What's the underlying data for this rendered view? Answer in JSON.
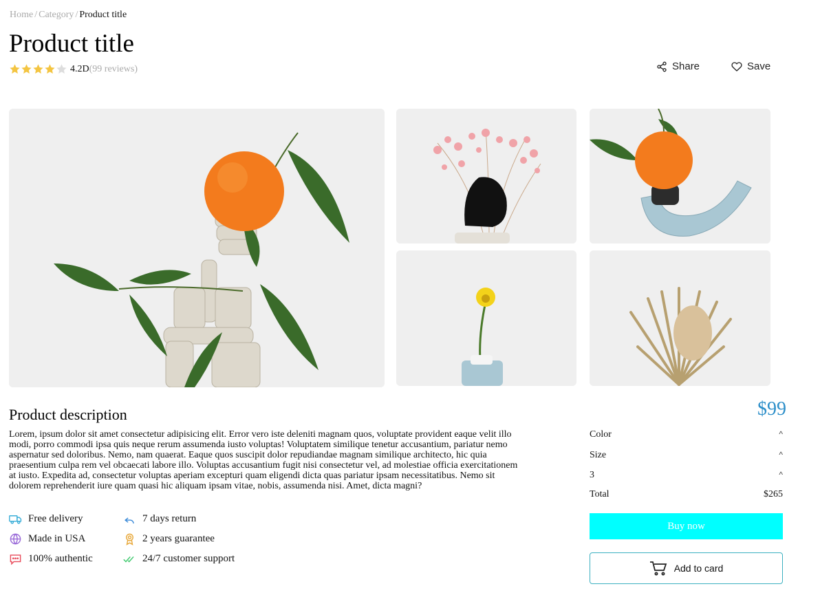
{
  "breadcrumb": {
    "home": "Home",
    "category": "Category",
    "current": "Product title",
    "separator": "/"
  },
  "product": {
    "title": "Product title",
    "rating": {
      "stars_filled": 4,
      "stars_total": 5,
      "value": "4.2D",
      "reviews": "(99 reviews)"
    }
  },
  "actions": {
    "share": "Share",
    "save": "Save",
    "share_icon": "share-icon",
    "save_icon": "heart-icon"
  },
  "gallery": {
    "images": [
      "orange-on-clay-sculpture",
      "pink-flowers-with-black-rock",
      "orange-on-blue-vase",
      "yellow-flower-in-blue-vase",
      "dried-protea-flower"
    ]
  },
  "description": {
    "title": "Product description",
    "text": "Lorem, ipsum dolor sit amet consectetur adipisicing elit. Error vero iste deleniti magnam quos, voluptate provident eaque velit illo modi, porro commodi ipsa quis neque rerum assumenda iusto voluptas! Voluptatem similique tenetur accusantium, pariatur nemo aspernatur sed doloribus. Nemo, nam quaerat. Eaque quos suscipit dolor repudiandae magnam similique architecto, hic quia praesentium culpa rem vel obcaecati labore illo. Voluptas accusantium fugit nisi consectetur vel, ad molestiae officia exercitationem at iusto. Expedita ad, consectetur voluptas aperiam excepturi quam eligendi dicta quas pariatur ipsam necessitatibus. Nemo sit dolorem reprehenderit iure quam quasi hic aliquam ipsam vitae, nobis, assumenda nisi. Amet, dicta magni?"
  },
  "features": [
    {
      "label": "Free delivery",
      "icon": "truck-icon"
    },
    {
      "label": "7 days return",
      "icon": "return-arrow-icon"
    },
    {
      "label": "Made in USA",
      "icon": "globe-icon"
    },
    {
      "label": "2 years guarantee",
      "icon": "award-icon"
    },
    {
      "label": "100% authentic",
      "icon": "chat-icon"
    },
    {
      "label": "24/7 customer support",
      "icon": "double-check-icon"
    }
  ],
  "purchase": {
    "price": "$99",
    "options": [
      {
        "label": "Color",
        "caret": "^"
      },
      {
        "label": "Size",
        "caret": "^"
      },
      {
        "label": "3",
        "caret": "^"
      }
    ],
    "total_label": "Total",
    "total_value": "$265",
    "buy_label": "Buy now",
    "cart_label": "Add to card",
    "cart_icon": "cart-icon"
  },
  "colors": {
    "price": "#2d8fc9",
    "buy_button": "#00ffff",
    "star": "#f4c542",
    "star_empty": "#dddddd",
    "cart_border": "#3bb0c0"
  }
}
